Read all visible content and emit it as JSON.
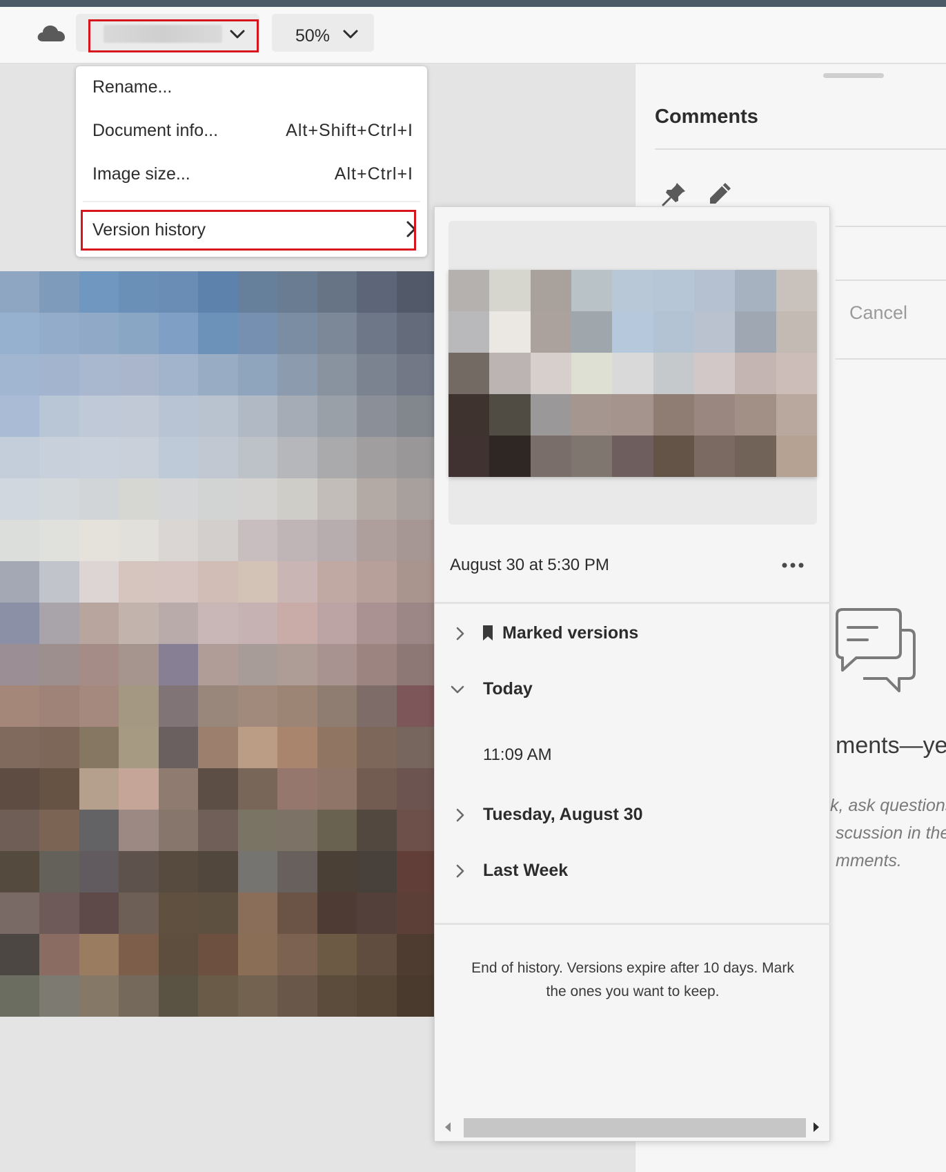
{
  "toolbar": {
    "document_name_label": "",
    "zoom_label": "50%"
  },
  "file_menu": {
    "items": [
      {
        "label": "Rename...",
        "shortcut": ""
      },
      {
        "label": "Document info...",
        "shortcut": "Alt+Shift+Ctrl+I"
      },
      {
        "label": "Image size...",
        "shortcut": "Alt+Ctrl+I"
      },
      {
        "label": "Version history",
        "shortcut": ""
      }
    ]
  },
  "comments": {
    "title": "Comments",
    "cancel_label": "Cancel",
    "empty_title": "ments—yet",
    "empty_lines": [
      "k, ask questions",
      "scussion in the",
      "mments."
    ]
  },
  "version_history": {
    "current_version": "August 30 at 5:30 PM",
    "groups": [
      {
        "label": "Marked versions",
        "expanded": false
      },
      {
        "label": "Today",
        "expanded": true,
        "entries": [
          "11:09 AM"
        ]
      },
      {
        "label": "Tuesday, August 30",
        "expanded": false
      },
      {
        "label": "Last Week",
        "expanded": false
      }
    ],
    "footer": "End of history. Versions expire after 10 days. Mark the ones you want to keep."
  },
  "colors": {
    "highlight_red": "#d7141c",
    "panel_bg": "#f5f5f5",
    "toolbar_bg": "#f8f8f8",
    "canvas_bg": "#e4e4e4"
  },
  "icons": [
    "cloud-icon",
    "chevron-down-icon",
    "chevron-right-icon",
    "pin-icon",
    "pencil-icon",
    "bookmark-icon",
    "more-icon",
    "chat-bubble-icon"
  ]
}
